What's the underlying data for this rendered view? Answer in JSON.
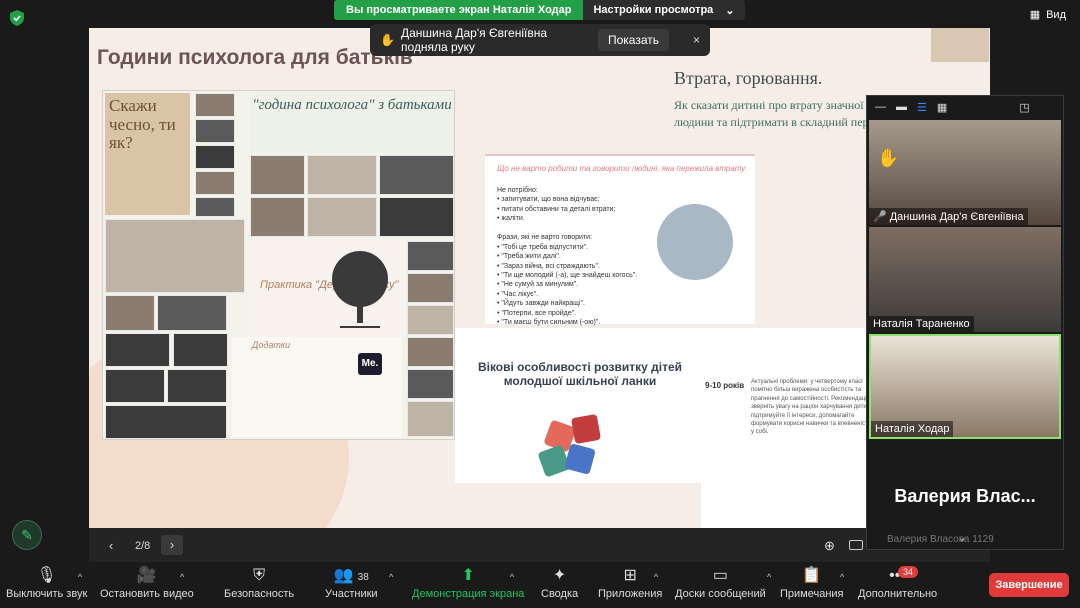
{
  "top": {
    "share_text": "Вы просматриваете экран Наталія Ходар",
    "view_options": "Настройки просмотра",
    "view_label": "Вид"
  },
  "notice": {
    "text": "Даншина Дар'я Євгеніївна подняла руку",
    "show": "Показать",
    "close": "×"
  },
  "slide": {
    "title": "Години психолога для батьків",
    "book_text": "Скажи чесно, ти як?",
    "hour_card": "\"година психолога\" з батьками",
    "tree_label": "Практика \"Дерево зв'язку\"",
    "addition_title": "Додатки",
    "me_logo": "Me.",
    "rules_head": "Що не варто робити та говорити людині, яка пережила втрату",
    "rules_text": "Не потрібно:\n• запитувати, що вона відчуває;\n• питати обставини та деталі втрати;\n• жаліти.\n\nФрази, які не варто говорити:\n• \"Тобі це треба відпустити\".\n• \"Треба жити далі\".\n• \"Зараз війна, всі страждають\".\n• \"Ти ще молодий (-а), ще знайдеш когось\".\n• \"Не сумуй за минулим\".\n• \"Час лікує\".\n• \"Йдуть завжди найкращі\".\n• \"Потерпи, все пройде\".\n• \"Ти маєш бути сильним (-ою)\".\n• \"Я розумію, що ти відчуваєш\".",
    "ages_title": "Вікові особливості розвитку дітей молодшої шкільної ланки",
    "loss_title": "Втрата, горювання.",
    "loss_sub": "Як сказати дитині про втрату значної людини та підтримати в складний період.",
    "text_age": "9-10 років",
    "text_body": "Актуальні проблеми: у четвертому класі помітно більш виражена особистість та прагнення до самостійності. Рекомендації: зверніть увагу на раціон харчування дитини, підтримуйте її інтереси, допомагайте формувати корисні навички та впевненість у собі."
  },
  "nav": {
    "prev": "‹",
    "page": "2/8",
    "next": "›"
  },
  "panel": {
    "participants": [
      {
        "name": "Даншина Дар'я Євгеніївна",
        "muted": true
      },
      {
        "name": "Наталія Тараненко",
        "muted": false
      },
      {
        "name": "Наталія Ходар",
        "muted": false
      }
    ],
    "big_name": "Валерия Влас...",
    "hidden_name": "Валерия Власова 1129"
  },
  "toolbar": {
    "mute": "Выключить звук",
    "video": "Остановить видео",
    "security": "Безопасность",
    "participants": "Участники",
    "participants_count": "38",
    "share": "Демонстрация экрана",
    "summary": "Сводка",
    "apps": "Приложения",
    "whiteboards": "Доски сообщений",
    "notes": "Примечания",
    "more": "Дополнительно",
    "more_badge": "34",
    "end": "Завершение"
  },
  "colors": {
    "green": "#23a047",
    "end_red": "#e03a3a",
    "active_tile": "#8be36b"
  }
}
